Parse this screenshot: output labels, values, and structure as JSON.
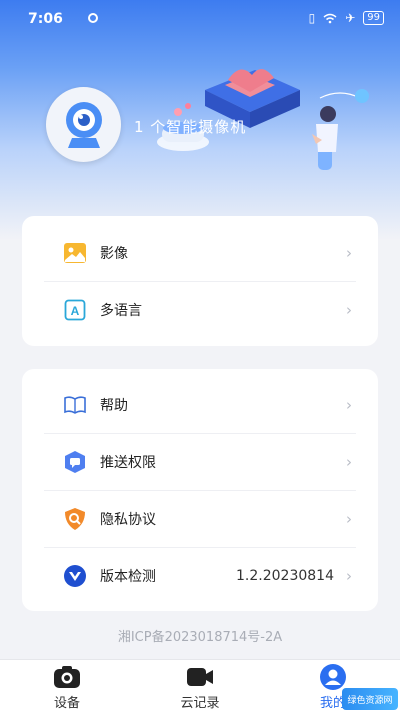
{
  "status_bar": {
    "time": "7:06",
    "battery": "99"
  },
  "header": {
    "device_count_text": "1 个智能摄像机"
  },
  "menu_group_1": [
    {
      "label": "影像",
      "icon": "image-icon"
    },
    {
      "label": "多语言",
      "icon": "language-icon"
    }
  ],
  "menu_group_2": [
    {
      "label": "帮助",
      "icon": "book-icon"
    },
    {
      "label": "推送权限",
      "icon": "message-icon"
    },
    {
      "label": "隐私协议",
      "icon": "shield-search-icon"
    },
    {
      "label": "版本检测",
      "icon": "version-icon",
      "value": "1.2.20230814"
    }
  ],
  "footer": {
    "icp": "湘ICP备2023018714号-2A"
  },
  "tabbar": {
    "tabs": [
      {
        "label": "设备",
        "icon": "camera-icon"
      },
      {
        "label": "云记录",
        "icon": "video-icon"
      },
      {
        "label": "我的",
        "icon": "user-icon",
        "active": true
      }
    ]
  },
  "watermark": "绿色资源网",
  "colors": {
    "accent": "#2a6ef0",
    "hero_top": "#3d7cf0",
    "background": "#f2f3f7"
  }
}
